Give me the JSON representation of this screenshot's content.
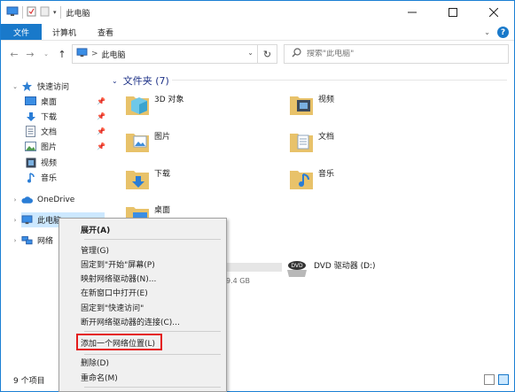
{
  "window": {
    "title": "此电脑",
    "controls": [
      "minimize",
      "maximize",
      "close"
    ]
  },
  "ribbon": {
    "tabs": [
      "文件",
      "计算机",
      "查看"
    ],
    "active_tab": "文件"
  },
  "navbar": {
    "breadcrumb_sep": ">",
    "breadcrumb": "此电脑",
    "search_placeholder": "搜索\"此电脑\""
  },
  "sidebar": {
    "quick_access": "快速访问",
    "quick_items": [
      "桌面",
      "下载",
      "文档",
      "图片",
      "视频",
      "音乐"
    ],
    "onedrive": "OneDrive",
    "this_pc": "此电脑",
    "network": "网络"
  },
  "main": {
    "group_title": "文件夹 (7)",
    "folders": [
      "3D 对象",
      "视频",
      "图片",
      "文档",
      "下载",
      "音乐",
      "桌面"
    ],
    "drive_label": "DVD 驱动器 (D:)",
    "partial_size_text": "9.4 GB"
  },
  "status": {
    "item_count": "9 个项目"
  },
  "context_menu": {
    "items": [
      "展开(A)",
      "管理(G)",
      "固定到\"开始\"屏幕(P)",
      "映射网络驱动器(N)...",
      "在新窗口中打开(E)",
      "固定到\"快速访问\"",
      "断开网络驱动器的连接(C)...",
      "添加一个网络位置(L)",
      "删除(D)",
      "重命名(M)"
    ]
  },
  "colors": {
    "accent": "#1979ca",
    "highlight_box": "#e41b1b",
    "selection": "#cce8ff"
  }
}
